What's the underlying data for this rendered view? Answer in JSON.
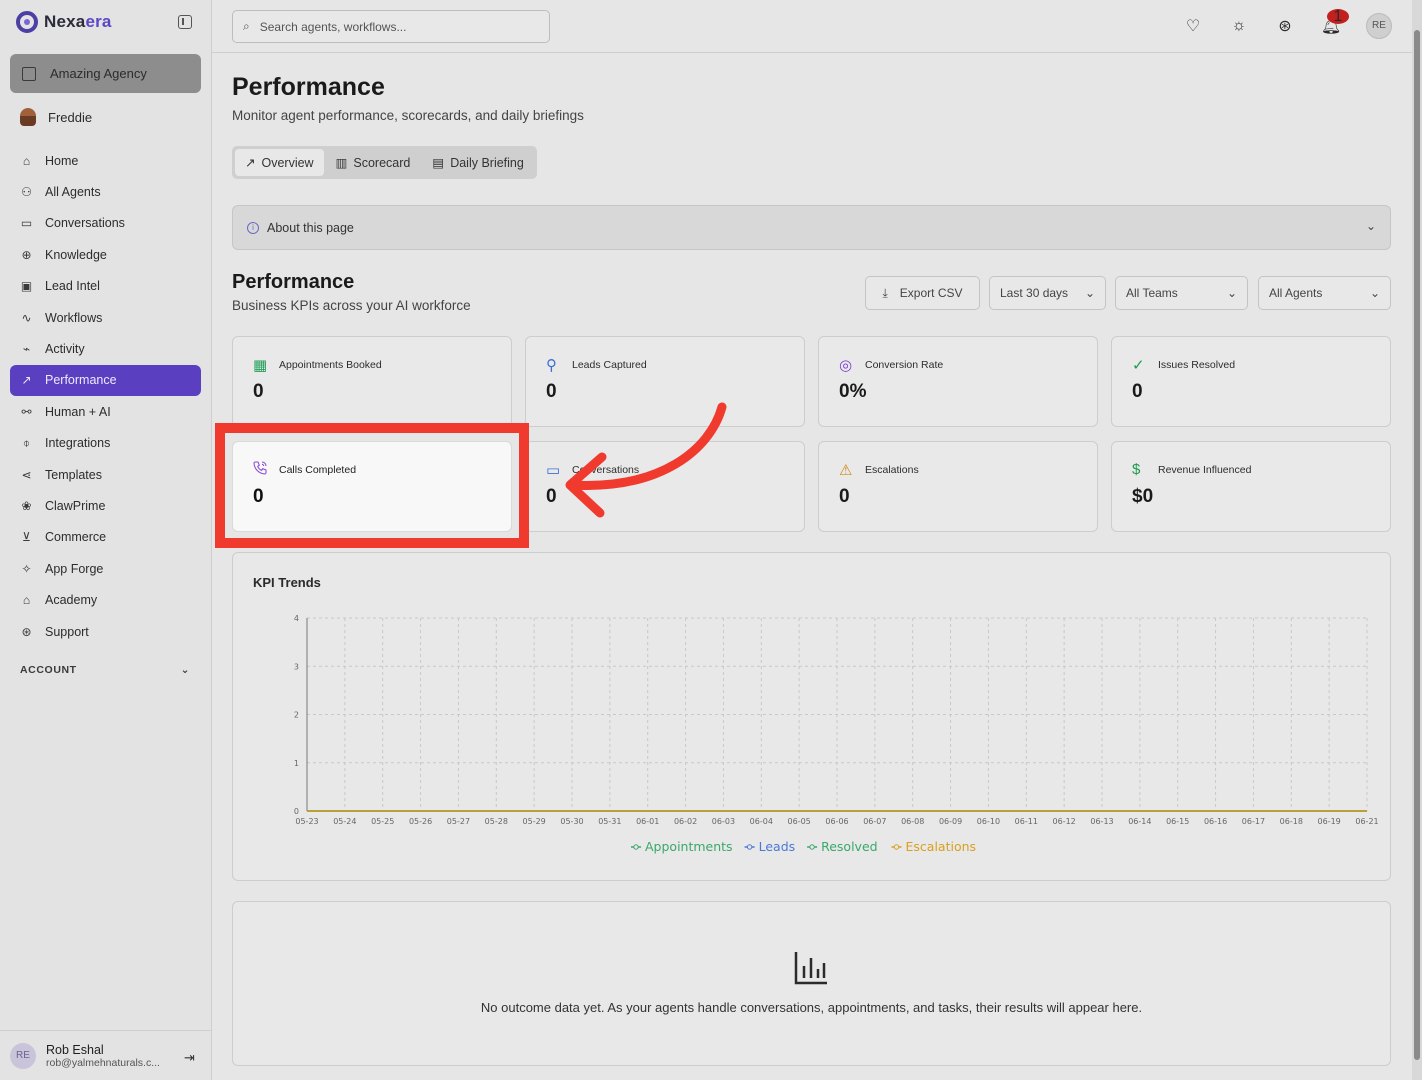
{
  "brand": {
    "name_a": "Nexa",
    "name_b": "era"
  },
  "sidebar": {
    "agency": "Amazing Agency",
    "user": "Freddie",
    "items": [
      {
        "label": "Home",
        "icon": "home-icon",
        "glyph": "⌂"
      },
      {
        "label": "All Agents",
        "icon": "bot-icon",
        "glyph": "⚇"
      },
      {
        "label": "Conversations",
        "icon": "chat-icon",
        "glyph": "▭"
      },
      {
        "label": "Knowledge",
        "icon": "brain-icon",
        "glyph": "⊕"
      },
      {
        "label": "Lead Intel",
        "icon": "contact-icon",
        "glyph": "▣"
      },
      {
        "label": "Workflows",
        "icon": "workflow-icon",
        "glyph": "∿"
      },
      {
        "label": "Activity",
        "icon": "activity-icon",
        "glyph": "⌁"
      },
      {
        "label": "Performance",
        "icon": "trend-icon",
        "glyph": "↗",
        "active": true
      },
      {
        "label": "Human + AI",
        "icon": "handshake-icon",
        "glyph": "⚯"
      },
      {
        "label": "Integrations",
        "icon": "plug-icon",
        "glyph": "⌽"
      },
      {
        "label": "Templates",
        "icon": "share-icon",
        "glyph": "⋖"
      },
      {
        "label": "ClawPrime",
        "icon": "paw-icon",
        "glyph": "❀"
      },
      {
        "label": "Commerce",
        "icon": "cart-icon",
        "glyph": "⊻"
      },
      {
        "label": "App Forge",
        "icon": "sparkles-icon",
        "glyph": "✧"
      },
      {
        "label": "Academy",
        "icon": "graduation-icon",
        "glyph": "⌂"
      },
      {
        "label": "Support",
        "icon": "lifebuoy-icon",
        "glyph": "⊛"
      }
    ],
    "account_label": "ACCOUNT",
    "footer": {
      "initials": "RE",
      "name": "Rob Eshal",
      "email": "rob@yalmehnaturals.c..."
    }
  },
  "topbar": {
    "search_placeholder": "Search agents, workflows...",
    "notification_count": "1",
    "avatar": "RE"
  },
  "page": {
    "title": "Performance",
    "subtitle": "Monitor agent performance, scorecards, and daily briefings",
    "tabs": [
      "Overview",
      "Scorecard",
      "Daily Briefing"
    ],
    "about": "About this page",
    "section_title": "Performance",
    "section_subtitle": "Business KPIs across your AI workforce",
    "export": "Export CSV",
    "range": "Last 30 days",
    "teams": "All Teams",
    "agents": "All Agents"
  },
  "kpis": [
    {
      "label": "Appointments Booked",
      "value": "0",
      "icon": "calendar-check-icon",
      "color": "#22a05a"
    },
    {
      "label": "Leads Captured",
      "value": "0",
      "icon": "user-plus-icon",
      "color": "#3b6fd6"
    },
    {
      "label": "Conversion Rate",
      "value": "0%",
      "icon": "target-icon",
      "color": "#7b3fd0"
    },
    {
      "label": "Issues Resolved",
      "value": "0",
      "icon": "check-circle-icon",
      "color": "#1f9a4e"
    },
    {
      "label": "Calls Completed",
      "value": "0",
      "icon": "phone-icon",
      "color": "#8a4bd6"
    },
    {
      "label": "Conversations",
      "value": "0",
      "icon": "message-icon",
      "color": "#3b6fd6"
    },
    {
      "label": "Escalations",
      "value": "0",
      "icon": "warning-icon",
      "color": "#d08a12"
    },
    {
      "label": "Revenue Influenced",
      "value": "$0",
      "icon": "dollar-icon",
      "color": "#1f9a4e"
    }
  ],
  "chart_title": "KPI Trends",
  "chart_data": {
    "type": "line",
    "categories": [
      "05-23",
      "05-24",
      "05-25",
      "05-26",
      "05-27",
      "05-28",
      "05-29",
      "05-30",
      "05-31",
      "06-01",
      "06-02",
      "06-03",
      "06-04",
      "06-05",
      "06-06",
      "06-07",
      "06-08",
      "06-09",
      "06-10",
      "06-11",
      "06-12",
      "06-13",
      "06-14",
      "06-15",
      "06-16",
      "06-17",
      "06-18",
      "06-19",
      "06-21"
    ],
    "ylim": [
      0,
      4
    ],
    "yticks": [
      0,
      1,
      2,
      3,
      4
    ],
    "grid": true,
    "legend": "bottom",
    "series": [
      {
        "name": "Appointments",
        "color": "#3aa86a",
        "values": [
          0,
          0,
          0,
          0,
          0,
          0,
          0,
          0,
          0,
          0,
          0,
          0,
          0,
          0,
          0,
          0,
          0,
          0,
          0,
          0,
          0,
          0,
          0,
          0,
          0,
          0,
          0,
          0,
          0
        ]
      },
      {
        "name": "Leads",
        "color": "#4a78d8",
        "values": [
          0,
          0,
          0,
          0,
          0,
          0,
          0,
          0,
          0,
          0,
          0,
          0,
          0,
          0,
          0,
          0,
          0,
          0,
          0,
          0,
          0,
          0,
          0,
          0,
          0,
          0,
          0,
          0,
          0
        ]
      },
      {
        "name": "Resolved",
        "color": "#3aa86a",
        "values": [
          0,
          0,
          0,
          0,
          0,
          0,
          0,
          0,
          0,
          0,
          0,
          0,
          0,
          0,
          0,
          0,
          0,
          0,
          0,
          0,
          0,
          0,
          0,
          0,
          0,
          0,
          0,
          0,
          0
        ]
      },
      {
        "name": "Escalations",
        "color": "#d9a020",
        "values": [
          0,
          0,
          0,
          0,
          0,
          0,
          0,
          0,
          0,
          0,
          0,
          0,
          0,
          0,
          0,
          0,
          0,
          0,
          0,
          0,
          0,
          0,
          0,
          0,
          0,
          0,
          0,
          0,
          0
        ]
      }
    ]
  },
  "empty_state": "No outcome data yet. As your agents handle conversations, appointments, and tasks, their results will appear here.",
  "annotation": {
    "highlight_color": "#f03a2e"
  }
}
